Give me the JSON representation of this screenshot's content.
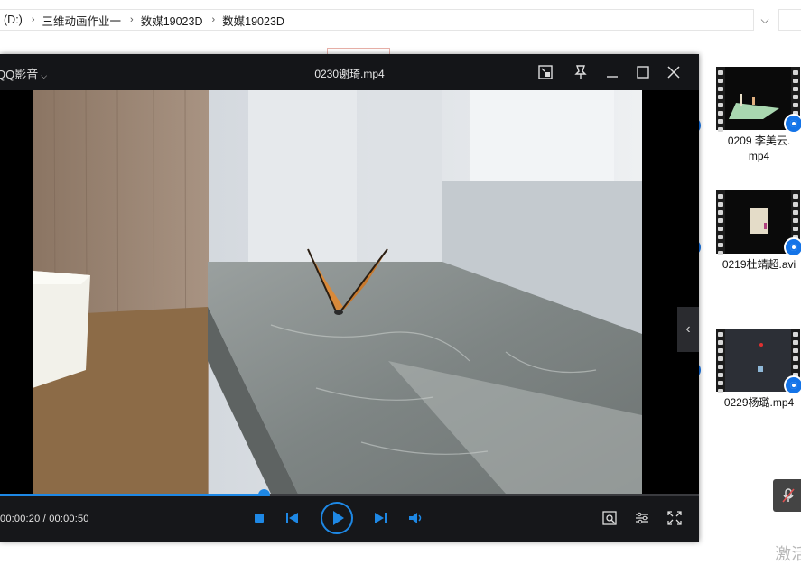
{
  "explorer": {
    "breadcrumb": [
      "(D:)",
      "三维动画作业一",
      "数媒19023D",
      "数媒19023D"
    ],
    "files": [
      {
        "name": "0209 李美云.\nmp4",
        "icon": "video-file-icon"
      },
      {
        "name": "0219杜靖超.avi",
        "icon": "video-file-icon"
      },
      {
        "name": "0229杨璐.mp4",
        "icon": "video-file-icon"
      }
    ],
    "faded_text": "激活"
  },
  "player": {
    "app_name": "QQ影音",
    "title": "0230谢琦.mp4",
    "time_current": "00:00:20",
    "time_separator": " / ",
    "time_total": "00:00:50",
    "progress_fraction": 0.4,
    "accent_color": "#1e88e5"
  }
}
